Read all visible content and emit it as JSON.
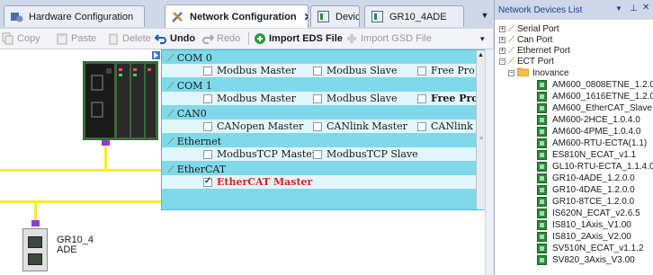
{
  "tabs": [
    {
      "label": "Hardware Configuration",
      "icon": "hardware-icon",
      "active": false
    },
    {
      "label": "Network Configuration",
      "icon": "network-config-icon",
      "active": true
    },
    {
      "label": "Device",
      "icon": "device-icon",
      "active": false
    },
    {
      "label": "GR10_4ADE",
      "icon": "device-icon",
      "active": false
    }
  ],
  "toolbar": {
    "copy": "Copy",
    "paste": "Paste",
    "delete": "Delete",
    "undo": "Undo",
    "redo": "Redo",
    "import_eds": "Import EDS File",
    "import_gsd": "Import GSD File"
  },
  "canvas": {
    "module_label_line1": "GR10_4",
    "module_label_line2": "ADE"
  },
  "network_panel": {
    "com0": {
      "label": "COM 0",
      "options": [
        {
          "label": "Modbus Master",
          "checked": false
        },
        {
          "label": "Modbus Slave",
          "checked": false
        },
        {
          "label": "Free Pro",
          "checked": false
        }
      ]
    },
    "com1": {
      "label": "COM 1",
      "options": [
        {
          "label": "Modbus Master",
          "checked": false
        },
        {
          "label": "Modbus Slave",
          "checked": false
        },
        {
          "label": "Free Pro",
          "checked": false
        }
      ]
    },
    "can0": {
      "label": "CAN0",
      "options": [
        {
          "label": "CANopen Master",
          "checked": false
        },
        {
          "label": "CANlink Master",
          "checked": false
        },
        {
          "label": "CANlink",
          "checked": false
        }
      ]
    },
    "ethernet": {
      "label": "Ethernet",
      "options": [
        {
          "label": "ModbusTCP Master",
          "checked": false
        },
        {
          "label": "ModbusTCP Slave",
          "checked": false
        }
      ]
    },
    "ethercat": {
      "label": "EtherCAT",
      "options": [
        {
          "label": "EtherCAT Master",
          "checked": true
        }
      ]
    }
  },
  "device_list": {
    "title": "Network Devices List",
    "pin_icon": "pin-icon",
    "categories": [
      "Serial Port",
      "Can Port",
      "Ethernet Port",
      "ECT Port"
    ],
    "vendor": "Inovance",
    "devices": [
      "AM600_0808ETNE_1.2.0",
      "AM600_1616ETNE_1.2.0",
      "AM600_EtherCAT_Slave",
      "AM600-2HCE_1.0.4.0",
      "AM600-4PME_1.0.4.0",
      "AM600-RTU-ECTA(1.1)",
      "ES810N_ECAT_v1.1",
      "GL10-RTU-ECTA_1.1.4.0",
      "GR10-4ADE_1.2.0.0",
      "GR10-4DAE_1.2.0.0",
      "GR10-8TCE_1.2.0.0",
      "IS620N_ECAT_v2.6.5",
      "IS810_1Axis_V1.00",
      "IS810_2Axis_V2.00",
      "SV510N_ECAT_v1.1.2",
      "SV820_3Axis_V3.00"
    ]
  },
  "colors": {
    "network_panel_bg": "#7fd9ea",
    "bus_line": "#f5ef2a",
    "ethercat_text": "#e0201a",
    "node_marker": "#8a3fd0"
  }
}
